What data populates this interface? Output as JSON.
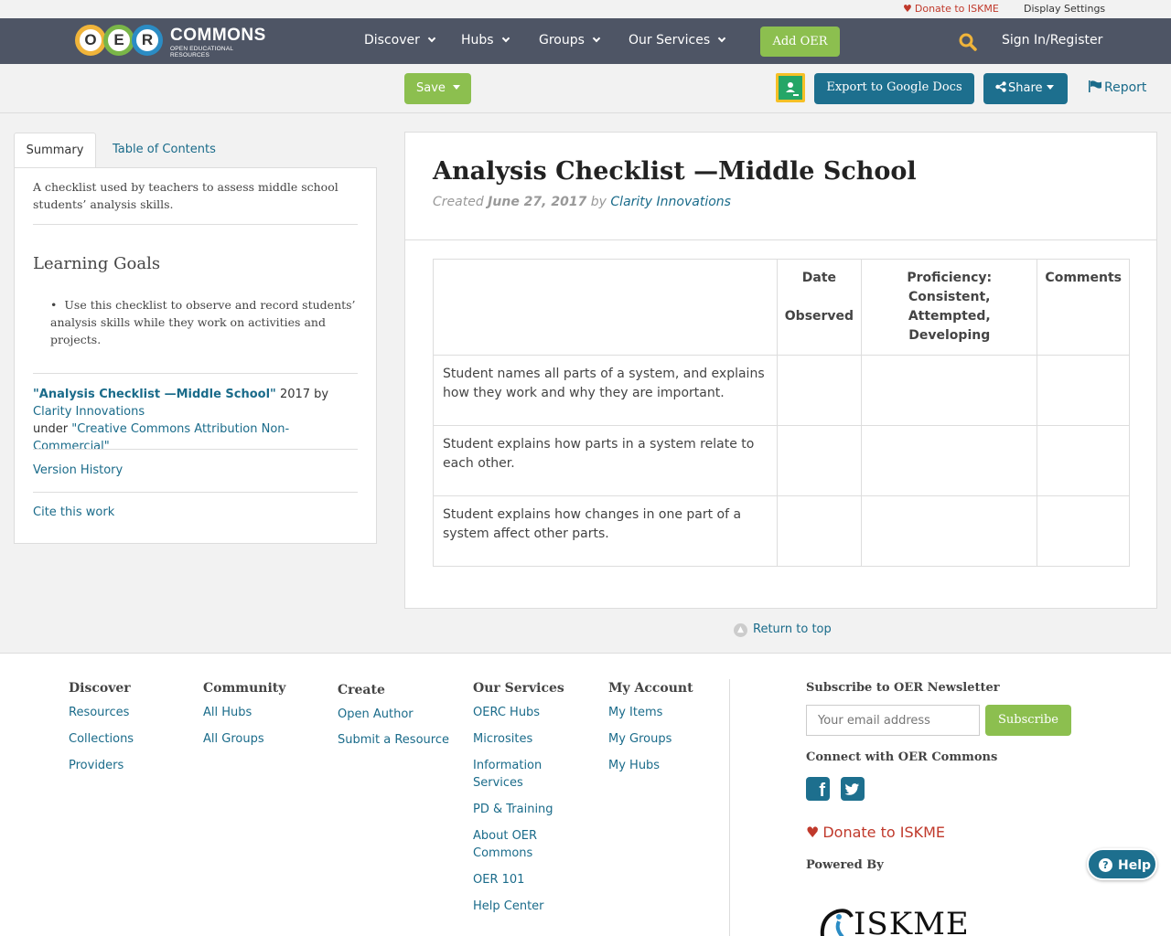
{
  "utility": {
    "donate": "Donate to ISKME",
    "display_settings": "Display Settings"
  },
  "brand": {
    "letters": [
      "O",
      "E",
      "R"
    ],
    "word": "COMMONS",
    "tagline": "OPEN EDUCATIONAL RESOURCES"
  },
  "nav": {
    "items": [
      {
        "label": "Discover"
      },
      {
        "label": "Hubs"
      },
      {
        "label": "Groups"
      },
      {
        "label": "Our Services"
      }
    ],
    "add_oer": "Add OER",
    "sign_in": "Sign In/Register"
  },
  "actions": {
    "save": "Save",
    "export": "Export to Google Docs",
    "share": "Share",
    "report": "Report"
  },
  "sidebar": {
    "tabs": [
      "Summary",
      "Table of Contents"
    ],
    "description": "A checklist used by teachers to assess middle school students’ analysis skills.",
    "learning_goals_title": "Learning Goals",
    "learning_goals": [
      "Use this checklist to observe and record students’ analysis skills while they work on activities and projects."
    ],
    "attribution": {
      "title": "\"Analysis Checklist —Middle School\"",
      "year_by": " 2017 by ",
      "author": "Clarity Innovations",
      "under": "under ",
      "license": "\"Creative Commons Attribution Non-Commercial\""
    },
    "version_history": "Version History",
    "cite": "Cite this work"
  },
  "resource": {
    "title": "Analysis Checklist —Middle School",
    "created_label": "Created",
    "date": "June 27, 2017",
    "by_label": "by",
    "author": "Clarity Innovations"
  },
  "checklist": {
    "headers": [
      "",
      "Date\n\nObserved",
      "Proficiency: Consistent, Attempted, Developing",
      "Comments"
    ],
    "rows": [
      "Student names all parts of a system, and explains how they work and why they are important.",
      "Student explains how parts in a system relate to each other.",
      "Student explains how changes in one part of a system affect other parts."
    ]
  },
  "return_to_top": "Return to top",
  "footer": {
    "columns": [
      {
        "title": "Discover",
        "links": [
          "Resources",
          "Collections",
          "Providers"
        ]
      },
      {
        "title": "Community",
        "links": [
          "All Hubs",
          "All Groups"
        ]
      },
      {
        "title": "Create",
        "links": [
          "Open Author",
          "Submit a Resource"
        ]
      },
      {
        "title": "Our Services",
        "links": [
          "OERC Hubs",
          "Microsites",
          "Information Services",
          "PD & Training",
          "About OER Commons",
          "OER 101",
          "Help Center"
        ]
      },
      {
        "title": "My Account",
        "links": [
          "My Items",
          "My Groups",
          "My Hubs"
        ]
      }
    ],
    "newsletter_title": "Subscribe to OER Newsletter",
    "email_placeholder": "Your email address",
    "subscribe": "Subscribe",
    "connect": "Connect with OER Commons",
    "donate": "Donate to ISKME",
    "powered_by": "Powered By",
    "iskme_logo": "ISKME"
  },
  "help": "Help",
  "colors": {
    "nav_bg": "#4e5565",
    "green": "#8cbf4f",
    "teal": "#1d6f8e",
    "link": "#1a6b8a",
    "donate_red": "#c0392b"
  }
}
